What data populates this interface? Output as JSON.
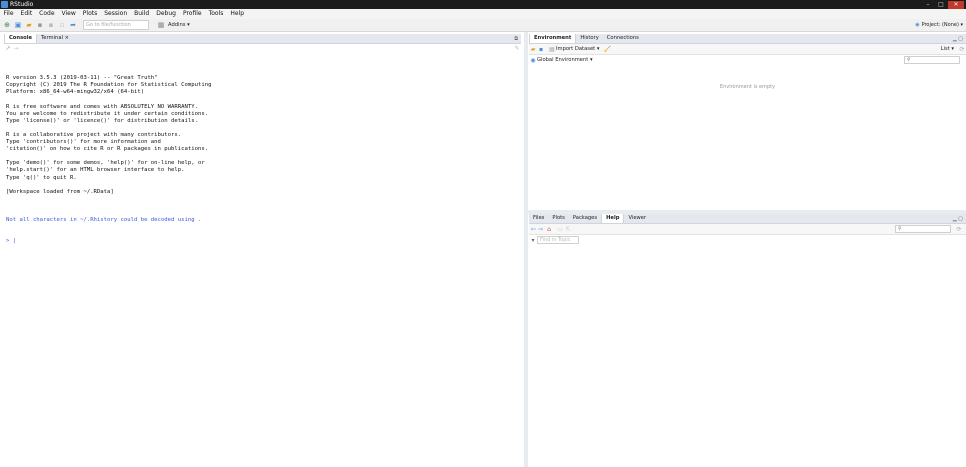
{
  "window": {
    "title": "RStudio",
    "minimize": "–",
    "maximize": "□",
    "close": "✕"
  },
  "menu": [
    "File",
    "Edit",
    "Code",
    "View",
    "Plots",
    "Session",
    "Build",
    "Debug",
    "Profile",
    "Tools",
    "Help"
  ],
  "toolbar": {
    "goto_placeholder": "Go to file/function",
    "addins": "Addins ▾",
    "project": "Project: (None) ▾"
  },
  "left_pane": {
    "tabs": {
      "console": "Console",
      "terminal": "Terminal ×"
    },
    "console_lines": [
      "R version 3.5.3 (2019-03-11) -- \"Great Truth\"",
      "Copyright (C) 2019 The R Foundation for Statistical Computing",
      "Platform: x86_64-w64-mingw32/x64 (64-bit)",
      "",
      "R is free software and comes with ABSOLUTELY NO WARRANTY.",
      "You are welcome to redistribute it under certain conditions.",
      "Type 'license()' or 'licence()' for distribution details.",
      "",
      "R is a collaborative project with many contributors.",
      "Type 'contributors()' for more information and",
      "'citation()' on how to cite R or R packages in publications.",
      "",
      "Type 'demo()' for some demos, 'help()' for on-line help, or",
      "'help.start()' for an HTML browser interface to help.",
      "Type 'q()' to quit R.",
      "",
      "[Workspace loaded from ~/.RData]",
      ""
    ],
    "warning": "Not all characters in ~/.Rhistory could be decoded using .",
    "prompt": "> |"
  },
  "env_pane": {
    "tabs": {
      "environment": "Environment",
      "history": "History",
      "connections": "Connections"
    },
    "import_dataset": "Import Dataset ▾",
    "list_view": "List ▾",
    "global_env": "Global Environment ▾",
    "empty_msg": "Environment is empty"
  },
  "files_pane": {
    "tabs": {
      "files": "Files",
      "plots": "Plots",
      "packages": "Packages",
      "help": "Help",
      "viewer": "Viewer"
    },
    "find_in_topic": "Find in Topic"
  }
}
